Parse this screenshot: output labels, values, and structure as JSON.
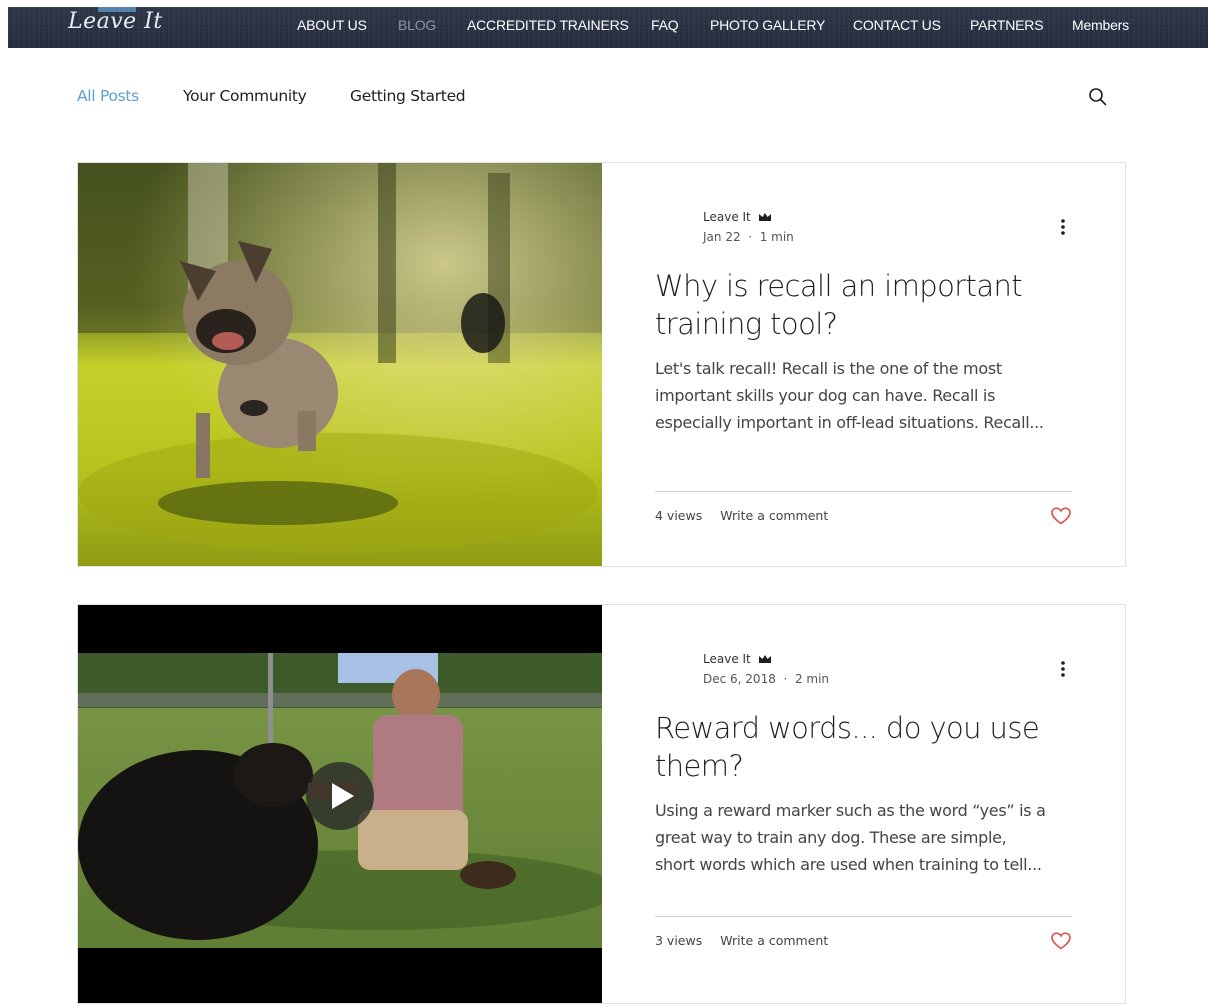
{
  "header": {
    "logo_text": "Leave It",
    "nav": [
      "ABOUT US",
      "BLOG",
      "ACCREDITED TRAINERS",
      "FAQ",
      "PHOTO GALLERY",
      "CONTACT US",
      "PARTNERS",
      "Members"
    ],
    "active_nav": "BLOG"
  },
  "blog_tabs": {
    "items": [
      "All Posts",
      "Your Community",
      "Getting Started"
    ],
    "active": "All Posts",
    "search_icon": "search-icon"
  },
  "posts": [
    {
      "author": "Leave It",
      "author_badge_icon": "crown-icon",
      "date": "Jan 22",
      "read_time": "1 min",
      "title": "Why is recall an important training tool?",
      "excerpt_lines": [
        "Let's talk recall! Recall is the one of the most",
        "important skills your dog can have. Recall is",
        "especially important in off-lead situations. Recall..."
      ],
      "views": "4 views",
      "comment_label": "Write a comment",
      "image_subject": "french-bulldog-running-on-grass",
      "has_video": false
    },
    {
      "author": "Leave It",
      "author_badge_icon": "crown-icon",
      "date": "Dec 6, 2018",
      "read_time": "2 min",
      "title": "Reward words... do you use them?",
      "excerpt_lines": [
        "Using a reward marker such as the word “yes” is a",
        "great way to train any dog. These are simple,",
        "short words which are used when training to tell..."
      ],
      "views": "3 views",
      "comment_label": "Write a comment",
      "image_subject": "man-shaking-paw-with-black-dog",
      "has_video": true
    }
  ],
  "colors": {
    "header_bg": "#262f40",
    "active_tab": "#5b9fd6",
    "like_heart": "#d9534f",
    "divider": "#cfcfcf"
  }
}
